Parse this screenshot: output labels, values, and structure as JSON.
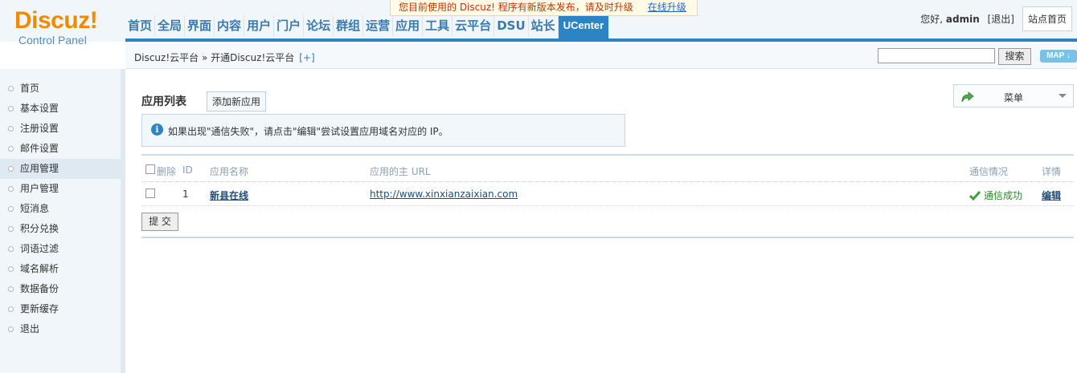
{
  "logo": {
    "main": "Discuz!",
    "sub": "Control Panel"
  },
  "notice": {
    "text": "您目前使用的 Discuz! 程序有新版本发布，请及时升级",
    "link": "在线升级"
  },
  "nav": [
    "首页",
    "全局",
    "界面",
    "内容",
    "用户",
    "门户",
    "论坛",
    "群组",
    "运营",
    "应用",
    "工具",
    "云平台",
    "DSU",
    "站长",
    "UCenter"
  ],
  "user": {
    "hello": "您好,",
    "name": "admin",
    "logout": "[退出]",
    "site_home": "站点首页"
  },
  "breadcrumb": {
    "path": "Discuz!云平台 » 开通Discuz!云平台",
    "plus": "[+]"
  },
  "search": {
    "button": "搜索",
    "map": "MAP ↓"
  },
  "sidebar": {
    "items": [
      "首页",
      "基本设置",
      "注册设置",
      "邮件设置",
      "应用管理",
      "用户管理",
      "短消息",
      "积分兑换",
      "词语过滤",
      "域名解析",
      "数据备份",
      "更新缓存",
      "退出"
    ],
    "active_index": 4
  },
  "main": {
    "title": "应用列表",
    "add_button": "添加新应用",
    "menu_label": "菜单",
    "tip": "如果出现\"通信失败\"，请点击\"编辑\"尝试设置应用域名对应的 IP。",
    "headers": {
      "delete": "删除",
      "id": "ID",
      "name": "应用名称",
      "url": "应用的主 URL",
      "status": "通信情况",
      "detail": "详情"
    },
    "rows": [
      {
        "id": "1",
        "name": "新县在线",
        "url": "http://www.xinxianzaixian.com",
        "status": "通信成功",
        "detail": "编辑"
      }
    ],
    "submit": "提 交"
  },
  "colors": {
    "brand_orange": "#f08a00",
    "accent_blue": "#2b84c6",
    "success_green": "#2a8a2a"
  }
}
